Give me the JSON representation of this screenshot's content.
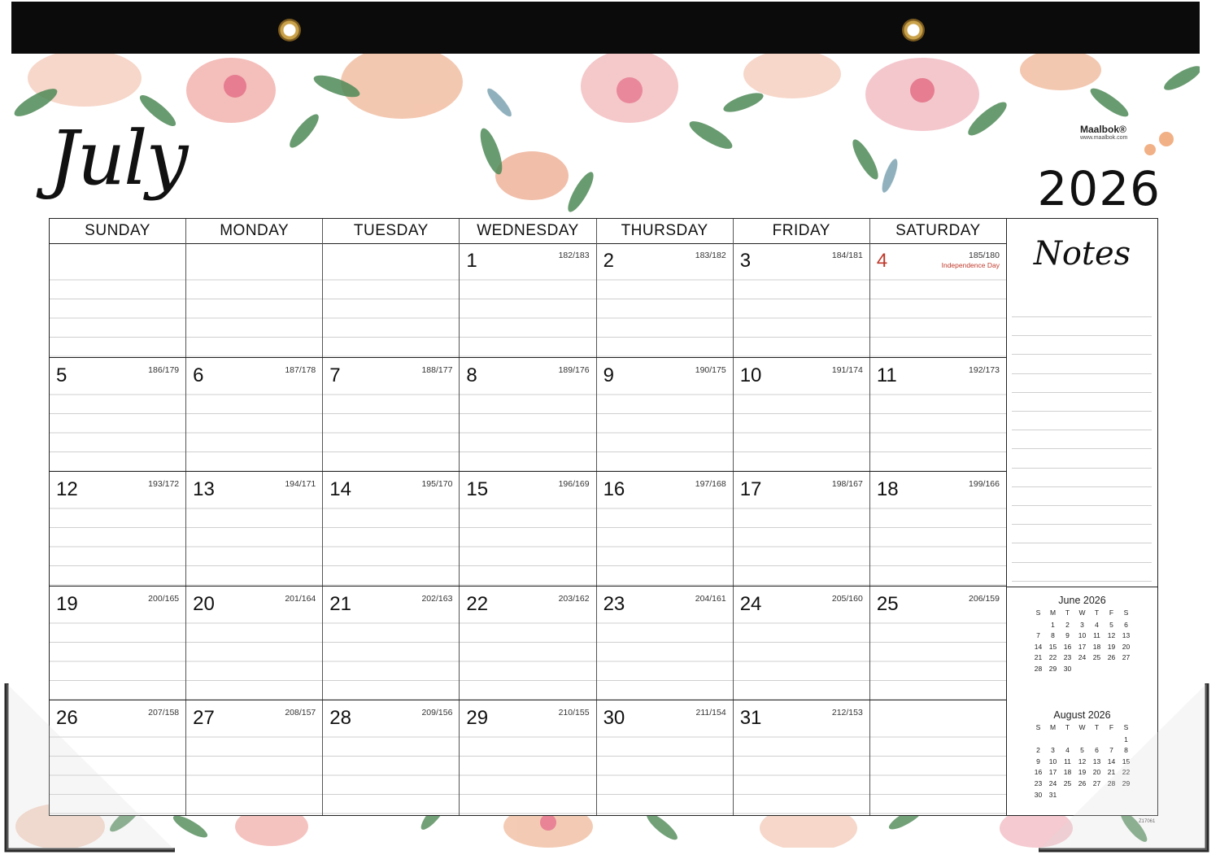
{
  "header": {
    "month": "July",
    "year": "2026",
    "brand_name": "Maalbok®",
    "brand_url": "www.maalbok.com"
  },
  "weekdays": [
    "SUNDAY",
    "MONDAY",
    "TUESDAY",
    "WEDNESDAY",
    "THURSDAY",
    "FRIDAY",
    "SATURDAY"
  ],
  "weeks": [
    [
      {
        "day": "",
        "count": ""
      },
      {
        "day": "",
        "count": ""
      },
      {
        "day": "",
        "count": ""
      },
      {
        "day": "1",
        "count": "182/183"
      },
      {
        "day": "2",
        "count": "183/182"
      },
      {
        "day": "3",
        "count": "184/181"
      },
      {
        "day": "4",
        "count": "185/180",
        "holiday": "Independence Day"
      }
    ],
    [
      {
        "day": "5",
        "count": "186/179"
      },
      {
        "day": "6",
        "count": "187/178"
      },
      {
        "day": "7",
        "count": "188/177"
      },
      {
        "day": "8",
        "count": "189/176"
      },
      {
        "day": "9",
        "count": "190/175"
      },
      {
        "day": "10",
        "count": "191/174"
      },
      {
        "day": "11",
        "count": "192/173"
      }
    ],
    [
      {
        "day": "12",
        "count": "193/172"
      },
      {
        "day": "13",
        "count": "194/171"
      },
      {
        "day": "14",
        "count": "195/170"
      },
      {
        "day": "15",
        "count": "196/169"
      },
      {
        "day": "16",
        "count": "197/168"
      },
      {
        "day": "17",
        "count": "198/167"
      },
      {
        "day": "18",
        "count": "199/166"
      }
    ],
    [
      {
        "day": "19",
        "count": "200/165"
      },
      {
        "day": "20",
        "count": "201/164"
      },
      {
        "day": "21",
        "count": "202/163"
      },
      {
        "day": "22",
        "count": "203/162"
      },
      {
        "day": "23",
        "count": "204/161"
      },
      {
        "day": "24",
        "count": "205/160"
      },
      {
        "day": "25",
        "count": "206/159"
      }
    ],
    [
      {
        "day": "26",
        "count": "207/158"
      },
      {
        "day": "27",
        "count": "208/157"
      },
      {
        "day": "28",
        "count": "209/156"
      },
      {
        "day": "29",
        "count": "210/155"
      },
      {
        "day": "30",
        "count": "211/154"
      },
      {
        "day": "31",
        "count": "212/153"
      },
      {
        "day": "",
        "count": ""
      }
    ]
  ],
  "notes": {
    "title": "Notes"
  },
  "mini_calendars": [
    {
      "title": "June 2026",
      "weekday_letters": [
        "S",
        "M",
        "T",
        "W",
        "T",
        "F",
        "S"
      ],
      "cells": [
        "",
        "1",
        "2",
        "3",
        "4",
        "5",
        "6",
        "7",
        "8",
        "9",
        "10",
        "11",
        "12",
        "13",
        "14",
        "15",
        "16",
        "17",
        "18",
        "19",
        "20",
        "21",
        "22",
        "23",
        "24",
        "25",
        "26",
        "27",
        "28",
        "29",
        "30",
        "",
        "",
        "",
        ""
      ]
    },
    {
      "title": "August 2026",
      "weekday_letters": [
        "S",
        "M",
        "T",
        "W",
        "T",
        "F",
        "S"
      ],
      "cells": [
        "",
        "",
        "",
        "",
        "",
        "",
        "1",
        "2",
        "3",
        "4",
        "5",
        "6",
        "7",
        "8",
        "9",
        "10",
        "11",
        "12",
        "13",
        "14",
        "15",
        "16",
        "17",
        "18",
        "19",
        "20",
        "21",
        "22",
        "23",
        "24",
        "25",
        "26",
        "27",
        "28",
        "29",
        "30",
        "31",
        "",
        "",
        "",
        "",
        ""
      ]
    }
  ],
  "product_code": "Z17061",
  "colors": {
    "holiday": "#c0392b",
    "top_bar": "#0b0b0b",
    "grid_line": "#222222"
  }
}
